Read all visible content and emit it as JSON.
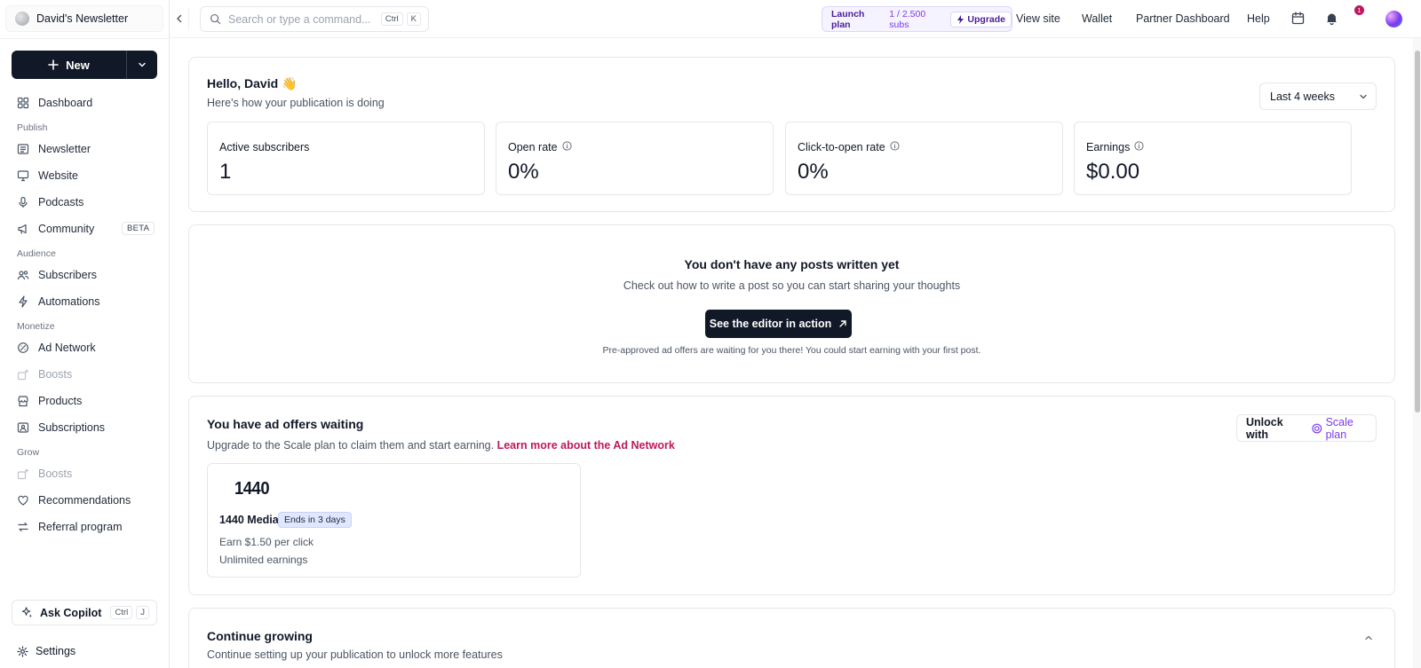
{
  "sidebar": {
    "publication": "David's Newsletter",
    "new_label": "New",
    "nav": [
      {
        "label": "Dashboard",
        "icon": "dashboard-icon"
      },
      {
        "section": "Publish"
      },
      {
        "label": "Newsletter",
        "icon": "newsletter-icon"
      },
      {
        "label": "Website",
        "icon": "monitor-icon"
      },
      {
        "label": "Podcasts",
        "icon": "microphone-icon"
      },
      {
        "label": "Community",
        "icon": "megaphone-icon",
        "badge": "BETA"
      },
      {
        "section": "Audience"
      },
      {
        "label": "Subscribers",
        "icon": "users-icon"
      },
      {
        "label": "Automations",
        "icon": "lightning-icon"
      },
      {
        "section": "Monetize"
      },
      {
        "label": "Ad Network",
        "icon": "ad-network-icon"
      },
      {
        "label": "Boosts",
        "icon": "boost-icon",
        "disabled": true
      },
      {
        "label": "Products",
        "icon": "store-icon"
      },
      {
        "label": "Subscriptions",
        "icon": "subscriptions-icon"
      },
      {
        "section": "Grow"
      },
      {
        "label": "Boosts",
        "icon": "boost-icon",
        "disabled": true
      },
      {
        "label": "Recommendations",
        "icon": "recommendations-icon"
      },
      {
        "label": "Referral program",
        "icon": "referral-icon"
      }
    ],
    "copilot": {
      "label": "Ask Copilot",
      "keys": [
        "Ctrl",
        "J"
      ]
    },
    "settings_label": "Settings"
  },
  "topbar": {
    "search_placeholder": "Search or type a command...",
    "search_keys": [
      "Ctrl",
      "K"
    ],
    "plan": {
      "name": "Launch plan",
      "subs": "1 / 2.500 subs",
      "upgrade": "Upgrade"
    },
    "links": [
      "View site",
      "Wallet",
      "Partner Dashboard",
      "Help"
    ],
    "notification_count": "1"
  },
  "overview": {
    "greeting": "Hello, David 👋",
    "subtitle": "Here's how your publication is doing",
    "range": "Last 4 weeks",
    "stats": [
      {
        "label": "Active subscribers",
        "value": "1",
        "info": false
      },
      {
        "label": "Open rate",
        "value": "0%",
        "info": true
      },
      {
        "label": "Click-to-open rate",
        "value": "0%",
        "info": true
      },
      {
        "label": "Earnings",
        "value": "$0.00",
        "info": true
      }
    ]
  },
  "empty": {
    "title": "You don't have any posts written yet",
    "subtitle": "Check out how to write a post so you can start sharing your thoughts",
    "button": "See the editor in action",
    "note": "Pre-approved ad offers are waiting for you there! You could start earning with your first post."
  },
  "ads": {
    "title": "You have ad offers waiting",
    "subtitle": "Upgrade to the Scale plan to claim them and start earning.",
    "link": "Learn more about the Ad Network",
    "unlock_prefix": "Unlock with",
    "unlock_plan": "Scale plan",
    "offer": {
      "logo_text": "1440",
      "name": "1440 Media",
      "badge": "Ends in 3 days",
      "line1": "Earn $1.50 per click",
      "line2": "Unlimited earnings"
    }
  },
  "grow": {
    "title": "Continue growing",
    "subtitle": "Continue setting up your publication to unlock more features"
  },
  "colors": {
    "primary": "#111827",
    "accent": "#7c3aed",
    "link": "#be185d"
  }
}
